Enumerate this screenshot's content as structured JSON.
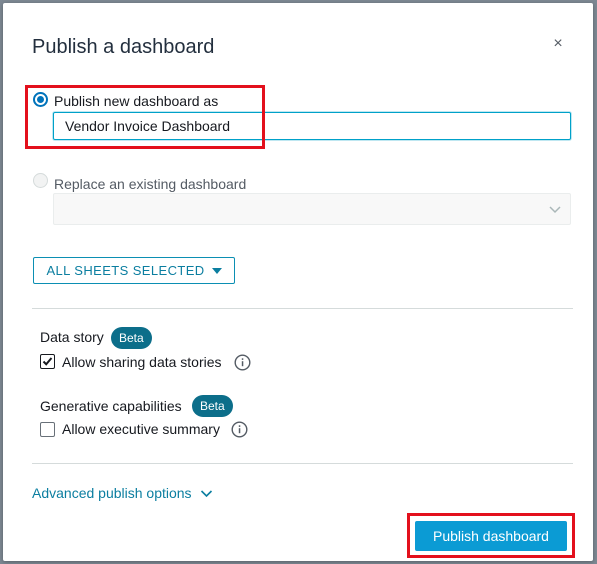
{
  "dialog": {
    "title": "Publish a dashboard",
    "close_glyph": "×"
  },
  "publish_new": {
    "label": "Publish new dashboard as",
    "selected": true,
    "value": "Vendor Invoice Dashboard"
  },
  "replace_existing": {
    "label": "Replace an existing dashboard",
    "selected": false,
    "select_value": ""
  },
  "sheets_button": {
    "label": "ALL SHEETS SELECTED"
  },
  "data_story": {
    "section_label": "Data story",
    "badge": "Beta",
    "checkbox_label": "Allow sharing data stories",
    "checked": true
  },
  "generative": {
    "section_label": "Generative capabilities",
    "badge": "Beta",
    "checkbox_label": "Allow executive summary",
    "checked": false
  },
  "advanced": {
    "label": "Advanced publish options"
  },
  "footer": {
    "publish_label": "Publish dashboard"
  },
  "colors": {
    "accent": "#0b9bd4",
    "highlight": "#e3101c",
    "badge": "#0c6e8a",
    "link": "#0b7ea0"
  },
  "icons": [
    "close-icon",
    "chevron-down-icon",
    "caret-down-icon",
    "info-icon",
    "checkmark-icon"
  ]
}
